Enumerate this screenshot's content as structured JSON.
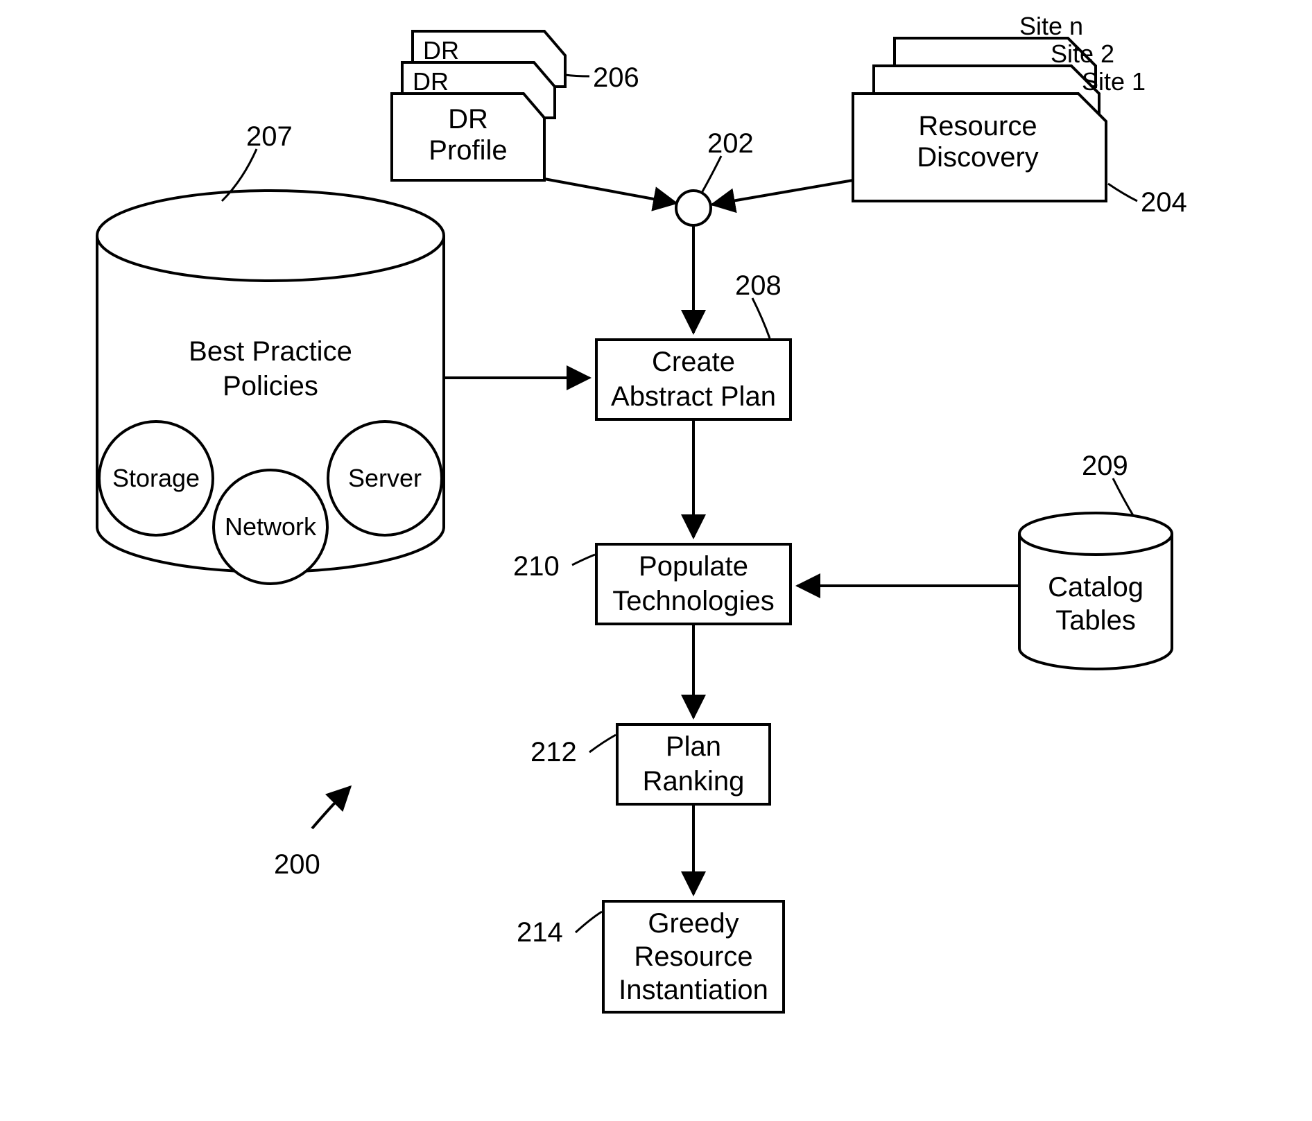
{
  "chart_data": {
    "type": "flowchart",
    "title": "",
    "nodes": [
      {
        "id": "200",
        "type": "figure-ref",
        "label": "200"
      },
      {
        "id": "202",
        "type": "junction",
        "label": "202"
      },
      {
        "id": "204",
        "type": "stacked-docs",
        "label": "Resource Discovery",
        "stack_labels": [
          "Site n",
          "Site 2",
          "Site 1"
        ],
        "ref": "204"
      },
      {
        "id": "206",
        "type": "stacked-docs",
        "label": "DR Profile",
        "stack_labels": [
          "DR",
          "DR"
        ],
        "ref": "206"
      },
      {
        "id": "207",
        "type": "cylinder",
        "label": "Best Practice Policies",
        "sub": [
          "Storage",
          "Network",
          "Server"
        ],
        "ref": "207"
      },
      {
        "id": "208",
        "type": "process",
        "label": "Create Abstract Plan",
        "ref": "208"
      },
      {
        "id": "209",
        "type": "cylinder",
        "label": "Catalog Tables",
        "ref": "209"
      },
      {
        "id": "210",
        "type": "process",
        "label": "Populate Technologies",
        "ref": "210"
      },
      {
        "id": "212",
        "type": "process",
        "label": "Plan Ranking",
        "ref": "212"
      },
      {
        "id": "214",
        "type": "process",
        "label": "Greedy Resource Instantiation",
        "ref": "214"
      }
    ],
    "edges": [
      {
        "from": "206",
        "to": "202"
      },
      {
        "from": "204",
        "to": "202"
      },
      {
        "from": "202",
        "to": "208"
      },
      {
        "from": "207",
        "to": "208"
      },
      {
        "from": "208",
        "to": "210"
      },
      {
        "from": "209",
        "to": "210"
      },
      {
        "from": "210",
        "to": "212"
      },
      {
        "from": "212",
        "to": "214"
      }
    ]
  },
  "labels": {
    "fig200": "200",
    "ref202": "202",
    "ref204": "204",
    "ref206": "206",
    "ref207": "207",
    "ref208": "208",
    "ref209": "209",
    "ref210": "210",
    "ref212": "212",
    "ref214": "214",
    "drProfile_l1": "DR",
    "drProfile_l2": "Profile",
    "drStack1": "DR",
    "drStack2": "DR",
    "resDisc_l1": "Resource",
    "resDisc_l2": "Discovery",
    "site1": "Site 1",
    "site2": "Site 2",
    "siten": "Site n",
    "bpp_l1": "Best Practice",
    "bpp_l2": "Policies",
    "storage": "Storage",
    "network": "Network",
    "server": "Server",
    "createAbs_l1": "Create",
    "createAbs_l2": "Abstract Plan",
    "catalog_l1": "Catalog",
    "catalog_l2": "Tables",
    "popTech_l1": "Populate",
    "popTech_l2": "Technologies",
    "planRank_l1": "Plan",
    "planRank_l2": "Ranking",
    "greedy_l1": "Greedy",
    "greedy_l2": "Resource",
    "greedy_l3": "Instantiation"
  }
}
